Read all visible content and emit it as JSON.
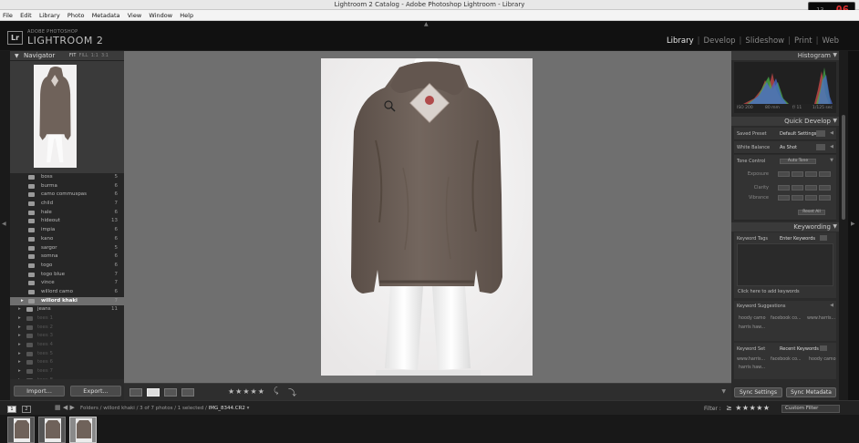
{
  "window": {
    "title": "Lightroom 2 Catalog - Adobe Photoshop Lightroom - Library",
    "clock_small": "13",
    "clock_big": "06"
  },
  "menu": [
    "File",
    "Edit",
    "Library",
    "Photo",
    "Metadata",
    "View",
    "Window",
    "Help"
  ],
  "identity": {
    "badge": "Lr",
    "brand_small": "ADOBE PHOTOSHOP",
    "brand_big": "LIGHTROOM 2",
    "modules": [
      "Library",
      "Develop",
      "Slideshow",
      "Print",
      "Web"
    ],
    "active_module": "Library"
  },
  "navigator": {
    "title": "Navigator",
    "zoom_options": [
      "FIT",
      "FILL",
      "1:1",
      "3:1"
    ]
  },
  "folders": [
    {
      "name": "boss",
      "count": "5",
      "kind": "child"
    },
    {
      "name": "burma",
      "count": "6",
      "kind": "child"
    },
    {
      "name": "camo commuspas",
      "count": "6",
      "kind": "child"
    },
    {
      "name": "child",
      "count": "7",
      "kind": "child"
    },
    {
      "name": "hale",
      "count": "6",
      "kind": "child"
    },
    {
      "name": "hideout",
      "count": "13",
      "kind": "child"
    },
    {
      "name": "impia",
      "count": "6",
      "kind": "child"
    },
    {
      "name": "kano",
      "count": "6",
      "kind": "child"
    },
    {
      "name": "sargor",
      "count": "5",
      "kind": "child"
    },
    {
      "name": "somna",
      "count": "6",
      "kind": "child"
    },
    {
      "name": "togo",
      "count": "6",
      "kind": "child"
    },
    {
      "name": "togo blue",
      "count": "7",
      "kind": "child"
    },
    {
      "name": "vince",
      "count": "7",
      "kind": "child"
    },
    {
      "name": "willord camo",
      "count": "6",
      "kind": "child"
    },
    {
      "name": "willord khaki",
      "count": "7",
      "kind": "selected"
    },
    {
      "name": "jeans",
      "count": "11",
      "kind": "top"
    },
    {
      "name": "tees 1",
      "count": "",
      "kind": "dim"
    },
    {
      "name": "tees 2",
      "count": "",
      "kind": "dim"
    },
    {
      "name": "tees 3",
      "count": "",
      "kind": "dim"
    },
    {
      "name": "tees 4",
      "count": "",
      "kind": "dim"
    },
    {
      "name": "tees 5",
      "count": "",
      "kind": "dim"
    },
    {
      "name": "tees 6",
      "count": "",
      "kind": "dim"
    },
    {
      "name": "tees 7",
      "count": "",
      "kind": "dim"
    },
    {
      "name": "tees 8",
      "count": "",
      "kind": "dim"
    }
  ],
  "left_buttons": {
    "import": "Import...",
    "export": "Export..."
  },
  "toolbar": {
    "stars": "★★★★★",
    "rotate_left": "⤹",
    "rotate_right": "⤵"
  },
  "right": {
    "histogram_title": "Histogram",
    "histogram_info": [
      "ISO 200",
      "80 mm",
      "f/ 11",
      "1/125 sec"
    ],
    "quick_develop_title": "Quick Develop",
    "saved_preset_label": "Saved Preset",
    "saved_preset_value": "Default Settings",
    "white_balance_label": "White Balance",
    "white_balance_value": "As Shot",
    "tone_control_label": "Tone Control",
    "auto_tone": "Auto Tone",
    "exposure_label": "Exposure",
    "clarity_label": "Clarity",
    "vibrance_label": "Vibrance",
    "reset_all": "Reset All",
    "keywording_title": "Keywording",
    "keyword_tags_label": "Keyword Tags",
    "keyword_tags_value": "Enter Keywords",
    "add_keywords_hint": "Click here to add keywords",
    "keyword_suggestions_label": "Keyword Suggestions",
    "suggestions": [
      "hoody camo",
      "facebook co...",
      "www.harris...",
      "harris haw..."
    ],
    "keyword_set_label": "Keyword Set",
    "keyword_set_value": "Recent Keywords",
    "keyword_set_items": [
      "www.harris...",
      "facebook co...",
      "hoody camo",
      "harris haw..."
    ],
    "sync_settings": "Sync Settings",
    "sync_metadata": "Sync Metadata"
  },
  "filmbar": {
    "page1": "1",
    "page2": "2",
    "path_prefix": "Folders / willord khaki / 3 of 7 photos / 1 selected / ",
    "path_file": "IMG_8344.CR2",
    "path_suffix": " ▾",
    "filter_label": "Filter :",
    "filter_stars": "≥ ★★★★★",
    "custom_filter": "Custom Filter"
  },
  "colors": {
    "jacket": "#6f625a",
    "jacket_dark": "#5a4e47",
    "mannequin": "#f7f7f7",
    "histogram_red": "#c84a4a",
    "histogram_green": "#4ab04a",
    "histogram_blue": "#4a6ad0"
  }
}
